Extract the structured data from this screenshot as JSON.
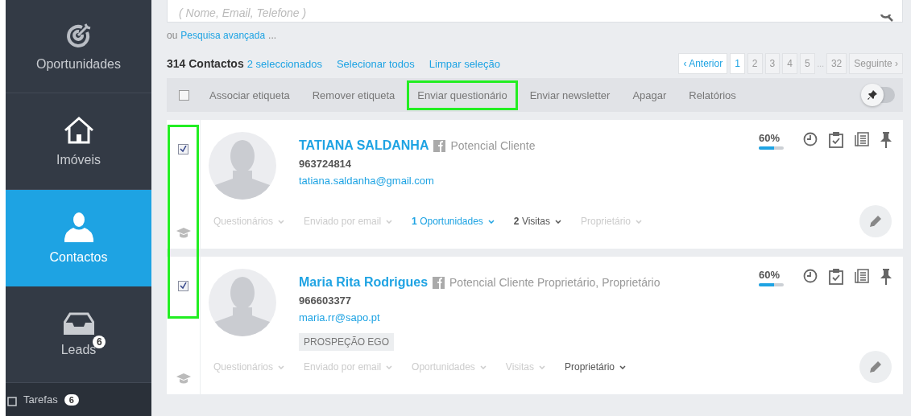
{
  "sidebar": {
    "items": [
      {
        "label": "Oportunidades",
        "selected": false
      },
      {
        "label": "Imóveis",
        "selected": false
      },
      {
        "label": "Contactos",
        "selected": true
      },
      {
        "label": "Leads",
        "selected": false,
        "badge": "6"
      }
    ],
    "footer": {
      "label": "Tarefas",
      "badge": "6"
    }
  },
  "search": {
    "placeholder": "( Nome, Email, Telefone )"
  },
  "advanced": {
    "prefix": "ou",
    "link": "Pesquisa avançada",
    "suffix": "..."
  },
  "summary": {
    "count": "314 Contactos",
    "selected": "2 seleccionados",
    "links": [
      "Selecionar todos",
      "Limpar seleção"
    ]
  },
  "pagination": {
    "previous": "‹ Anterior",
    "pages": [
      {
        "label": "1",
        "selected": true
      },
      {
        "label": "2",
        "selected": false
      },
      {
        "label": "3",
        "selected": false
      },
      {
        "label": "4",
        "selected": false
      },
      {
        "label": "5",
        "selected": false
      },
      {
        "label": "...",
        "kind": "gap"
      },
      {
        "label": "32",
        "selected": false
      }
    ],
    "next": "Seguinte ›"
  },
  "actions": {
    "select_all_checked": false,
    "items": [
      {
        "label": "Associar etiqueta",
        "highlighted": false
      },
      {
        "label": "Remover etiqueta",
        "highlighted": false
      },
      {
        "label": "Enviar questionário",
        "highlighted": true
      },
      {
        "label": "Enviar newsletter",
        "highlighted": false
      },
      {
        "label": "Apagar",
        "highlighted": false
      },
      {
        "label": "Relatórios",
        "highlighted": false
      }
    ],
    "pin_toggle_on": false
  },
  "checkbox_column_highlighted": true,
  "contacts": [
    {
      "checked": true,
      "name": "TATIANA SALDANHA",
      "category": "Potencial Cliente",
      "phone": "963724814",
      "email": "tatiana.saldanha@gmail.com",
      "progress": "60%",
      "level": 0.6,
      "links": [
        {
          "text": "Questionários",
          "kind": "muted"
        },
        {
          "text": "Enviado por email",
          "kind": "muted"
        },
        {
          "text": "**1** Oportunidades",
          "kind": "link"
        },
        {
          "text": "**2** Visitas",
          "kind": "dark"
        },
        {
          "text": "Proprietário",
          "kind": "muted"
        }
      ]
    },
    {
      "checked": true,
      "name": "Maria Rita Rodrigues",
      "category": "Potencial Cliente Proprietário, Proprietário",
      "phone": "966603377",
      "email": "maria.rr@sapo.pt",
      "tags": [
        "PROSPEÇÃO EGO"
      ],
      "progress": "60%",
      "level": 0.6,
      "links": [
        {
          "text": "Questionários",
          "kind": "muted"
        },
        {
          "text": "Enviado por email",
          "kind": "muted"
        },
        {
          "text": "Oportunidades",
          "kind": "muted"
        },
        {
          "text": "Visitas",
          "kind": "muted"
        },
        {
          "text": "Proprietário",
          "kind": "dark"
        }
      ]
    }
  ]
}
